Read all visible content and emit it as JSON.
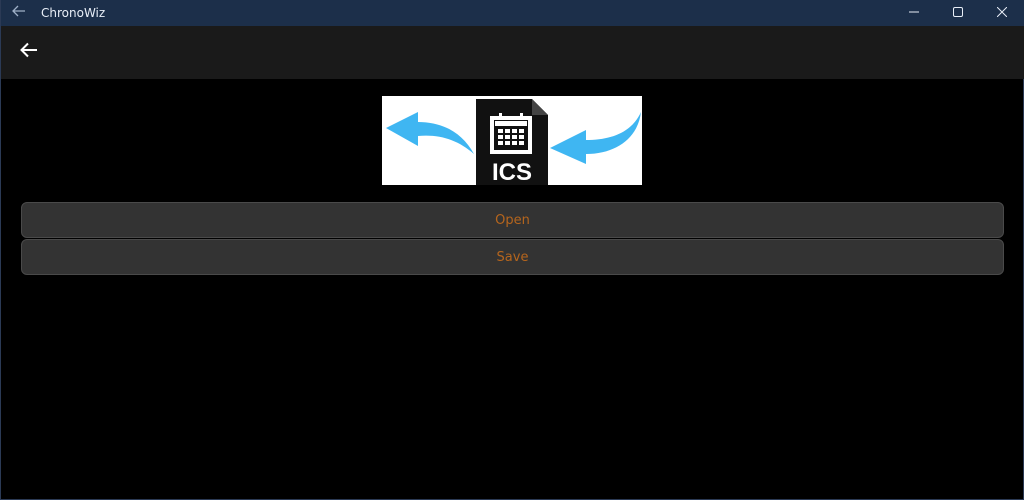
{
  "window": {
    "title": "ChronoWiz"
  },
  "icons": {
    "titlebar_back": "arrow-left-icon",
    "minimize": "minimize-icon",
    "maximize": "maximize-icon",
    "close": "close-icon",
    "nav_back": "arrow-left-icon"
  },
  "image": {
    "label": "ICS"
  },
  "actions": {
    "open_label": "Open",
    "save_label": "Save"
  },
  "colors": {
    "titlebar": "#1c2f4a",
    "header": "#1a1a1a",
    "background": "#000000",
    "button_bg": "#333333",
    "button_text": "#b5651d",
    "arrow_blue": "#3fb6f2"
  }
}
